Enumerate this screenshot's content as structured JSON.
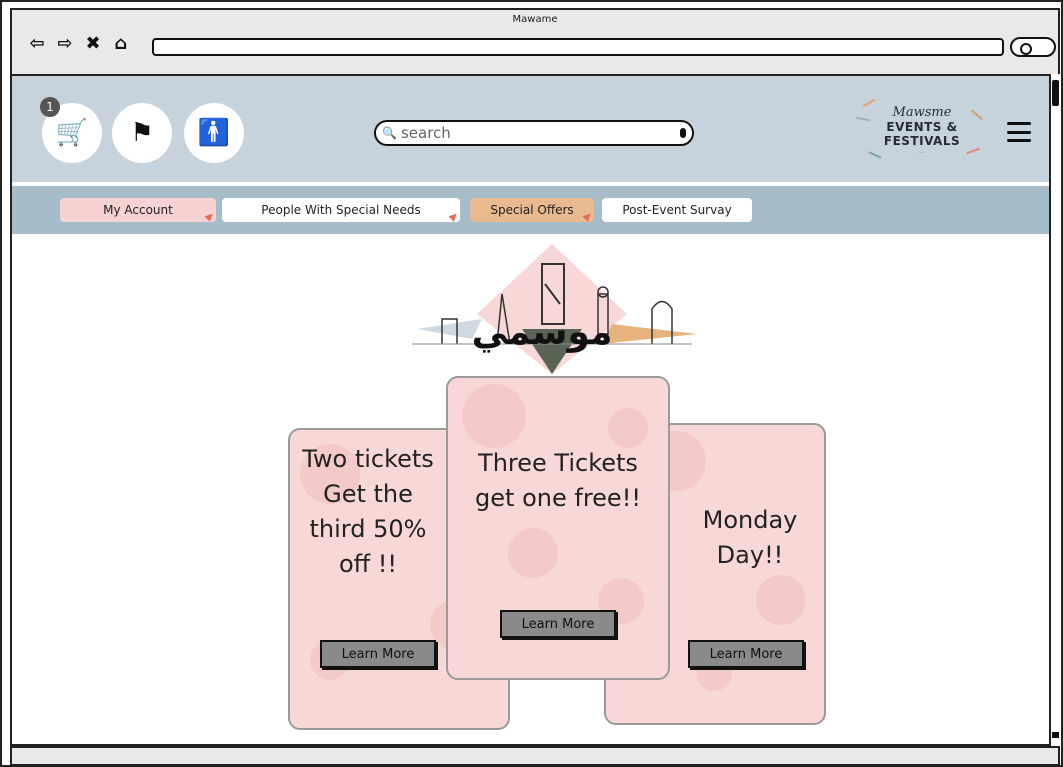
{
  "window": {
    "title": "Mawame"
  },
  "header": {
    "cart_badge": "1",
    "search_placeholder": "search",
    "logo": {
      "script": "Mawsme",
      "line1": "EVENTS &",
      "line2": "FESTIVALS"
    }
  },
  "tabs": [
    {
      "label": "My Account",
      "color": "#f6d2d2"
    },
    {
      "label": "People With Special Needs",
      "color": "#ffffff"
    },
    {
      "label": "Special Offers",
      "color": "#e9b98f"
    },
    {
      "label": "Post-Event Survay",
      "color": "#ffffff"
    }
  ],
  "hero": {
    "logo_text": "موسمي"
  },
  "offers": [
    {
      "title": "Two tickets Get the third 50% off !!",
      "button": "Learn More"
    },
    {
      "title": "Three Tickets get one free!!",
      "button": "Learn More"
    },
    {
      "title": "Monday Day!!",
      "button": "Learn More"
    }
  ],
  "colors": {
    "header_bg": "#c6d3dc",
    "tabbar_bg": "#a7bcc9",
    "card_bg": "#f7d8d6"
  }
}
